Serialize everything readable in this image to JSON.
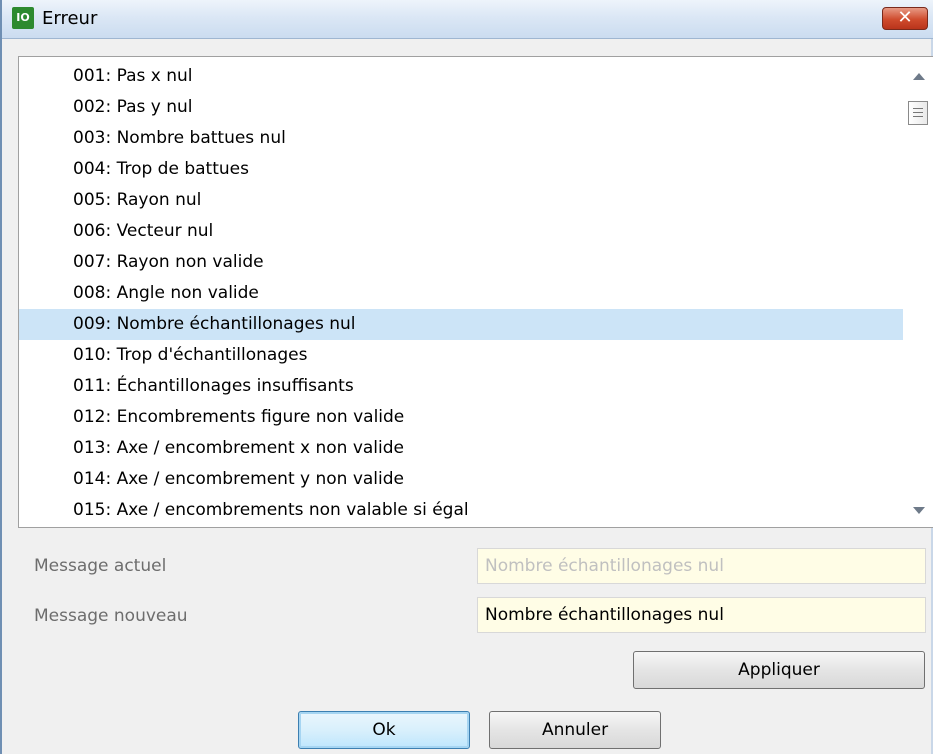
{
  "window": {
    "title": "Erreur",
    "close_glyph": "✕",
    "app_icon_text": "IO"
  },
  "list": {
    "selected_index": 8,
    "items": [
      "001: Pas x nul",
      "002: Pas y nul",
      "003: Nombre battues nul",
      "004: Trop de battues",
      "005: Rayon nul",
      "006: Vecteur nul",
      "007: Rayon non valide",
      "008: Angle non valide",
      "009: Nombre échantillonages nul",
      "010: Trop d'échantillonages",
      "011: Échantillonages insuffisants",
      "012: Encombrements figure non valide",
      "013: Axe / encombrement x non valide",
      "014: Axe / encombrement y non valide",
      "015: Axe / encombrements non valable si égal"
    ]
  },
  "form": {
    "current_label": "Message actuel",
    "current_value": "Nombre échantillonages nul",
    "new_label": "Message nouveau",
    "new_value": "Nombre échantillonages nul"
  },
  "buttons": {
    "apply": "Appliquer",
    "ok": "Ok",
    "cancel": "Annuler"
  },
  "colors": {
    "selection": "#cce4f7",
    "field_bg": "#fffde6",
    "close": "#cf4b2d"
  }
}
